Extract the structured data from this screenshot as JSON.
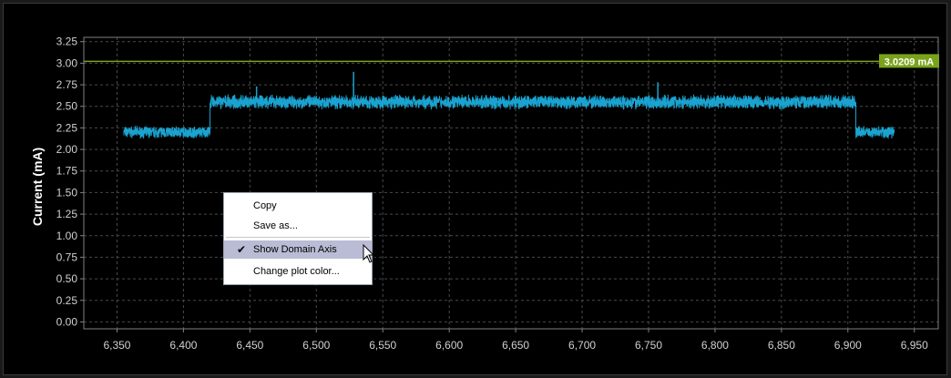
{
  "chart_data": {
    "type": "line",
    "ylabel": "Current (mA)",
    "xlabel": "",
    "xlim": [
      6325,
      6968
    ],
    "ylim": [
      -0.08,
      3.3
    ],
    "x_ticks": [
      6350,
      6400,
      6450,
      6500,
      6550,
      6600,
      6650,
      6700,
      6750,
      6800,
      6850,
      6900,
      6950
    ],
    "x_tick_labels": [
      "6,350",
      "6,400",
      "6,450",
      "6,500",
      "6,550",
      "6,600",
      "6,650",
      "6,700",
      "6,750",
      "6,800",
      "6,850",
      "6,900",
      "6,950"
    ],
    "y_ticks": [
      0,
      0.25,
      0.5,
      0.75,
      1.0,
      1.25,
      1.5,
      1.75,
      2.0,
      2.25,
      2.5,
      2.75,
      3.0,
      3.25
    ],
    "y_tick_labels": [
      "0.00",
      "0.25",
      "0.50",
      "0.75",
      "1.00",
      "1.25",
      "1.50",
      "1.75",
      "2.00",
      "2.25",
      "2.50",
      "2.75",
      "3.00",
      "3.25"
    ],
    "grid": true,
    "series": [
      {
        "color": "#1aa3d0",
        "segments": [
          {
            "x_start": 6355,
            "x_end": 6420,
            "mean": 2.2,
            "noise": 0.05
          },
          {
            "x_start": 6420,
            "x_end": 6906,
            "mean": 2.55,
            "noise": 0.06
          },
          {
            "x_start": 6906,
            "x_end": 6935,
            "mean": 2.2,
            "noise": 0.05
          }
        ],
        "spikes": [
          {
            "x": 6528,
            "y": 2.9
          },
          {
            "x": 6455,
            "y": 2.73
          },
          {
            "x": 6757,
            "y": 2.78
          }
        ]
      }
    ],
    "threshold": {
      "value": 3.0209,
      "label": "3.0209 mA",
      "color": "#7aa31c"
    }
  },
  "context_menu": {
    "items": [
      {
        "label": "Copy",
        "checked": false
      },
      {
        "label": "Save as...",
        "checked": false
      },
      {
        "label": "Show Domain Axis",
        "checked": true
      },
      {
        "label": "Change plot color...",
        "checked": false
      }
    ],
    "check_glyph": "✔"
  },
  "colors": {
    "background": "#000000",
    "grid": "#4a4a4a",
    "axis": "#808080",
    "tick_text": "#d0d0d0",
    "label_text": "#ffffff",
    "menu_highlight": "#b9bcd4"
  },
  "icons": {
    "cursor": "arrow-cursor-icon"
  }
}
